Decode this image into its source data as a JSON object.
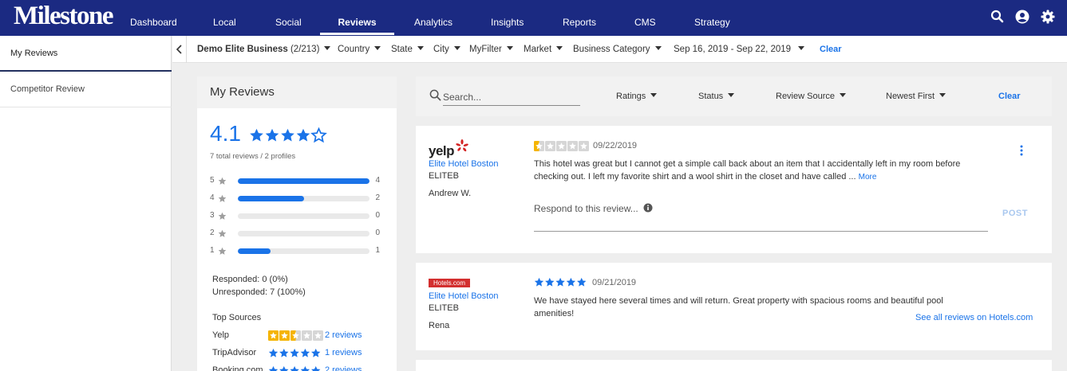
{
  "app": {
    "logo": "Milestone"
  },
  "nav": {
    "items": [
      {
        "label": "Dashboard",
        "active": false
      },
      {
        "label": "Local",
        "active": false
      },
      {
        "label": "Social",
        "active": false
      },
      {
        "label": "Reviews",
        "active": true
      },
      {
        "label": "Analytics",
        "active": false
      },
      {
        "label": "Insights",
        "active": false
      },
      {
        "label": "Reports",
        "active": false
      },
      {
        "label": "CMS",
        "active": false
      },
      {
        "label": "Strategy",
        "active": false
      }
    ],
    "icons": [
      "search-icon",
      "account-icon",
      "gear-icon"
    ]
  },
  "sidebar": {
    "items": [
      {
        "label": "My Reviews",
        "active": true
      },
      {
        "label": "Competitor Review",
        "active": false
      }
    ]
  },
  "filters": {
    "business": "Demo Elite Business",
    "business_count": "(2/213)",
    "items": [
      "Country",
      "State",
      "City",
      "MyFilter",
      "Market",
      "Business Category"
    ],
    "date_range": "Sep 16, 2019 - Sep 22, 2019",
    "clear": "Clear"
  },
  "summary": {
    "title": "My Reviews",
    "rating": "4.1",
    "rating_value": 4.1,
    "total": "7 total reviews / 2 profiles",
    "distribution": [
      {
        "star": "5",
        "count": "4",
        "value": 4
      },
      {
        "star": "4",
        "count": "2",
        "value": 2
      },
      {
        "star": "3",
        "count": "0",
        "value": 0
      },
      {
        "star": "2",
        "count": "0",
        "value": 0
      },
      {
        "star": "1",
        "count": "1",
        "value": 1
      }
    ],
    "responded": "Responded: 0 (0%)",
    "unresponded": "Unresponded: 7 (100%)",
    "top_sources_title": "Top Sources",
    "sources": [
      {
        "name": "Yelp",
        "rating": 2.5,
        "color": "#f5b400",
        "link": "2 reviews"
      },
      {
        "name": "TripAdvisor",
        "rating": 5,
        "color": "#1a73e8",
        "link": "1 reviews"
      },
      {
        "name": "Booking.com",
        "rating": 5,
        "color": "#1a73e8",
        "link": "2 reviews"
      }
    ]
  },
  "search": {
    "placeholder": "Search...",
    "filters": [
      "Ratings",
      "Status",
      "Review Source",
      "Newest First"
    ],
    "clear": "Clear"
  },
  "reviews": [
    {
      "source": "yelp",
      "source_logo_text": "yelp",
      "hotel": "Elite Hotel Boston",
      "code": "ELITEB",
      "reviewer": "Andrew W.",
      "rating": 0.5,
      "star_color": "#f5b400",
      "date": "09/22/2019",
      "text": "This hotel was great but I cannot get a simple call back about an item that I accidentally left in my room before checking out. I left my favorite shirt and a wool shirt in the closet and have called ...",
      "more": "More",
      "respond_placeholder": "Respond to this review...",
      "post": "POST"
    },
    {
      "source": "hotels.com",
      "source_logo_text": "Hotels.com",
      "hotel": "Elite Hotel Boston",
      "code": "ELITEB",
      "reviewer": "Rena",
      "rating": 5,
      "star_color": "#1a73e8",
      "date": "09/21/2019",
      "text": "We have stayed here several times and will return. Great property with spacious rooms and beautiful pool amenities!",
      "see_all": "See all reviews on Hotels.com"
    }
  ],
  "colors": {
    "brand": "#1b2a82",
    "accent": "#1a73e8",
    "yelp_star": "#f5b400",
    "yelp_red": "#d32323",
    "hotels_red": "#d32f2f"
  }
}
